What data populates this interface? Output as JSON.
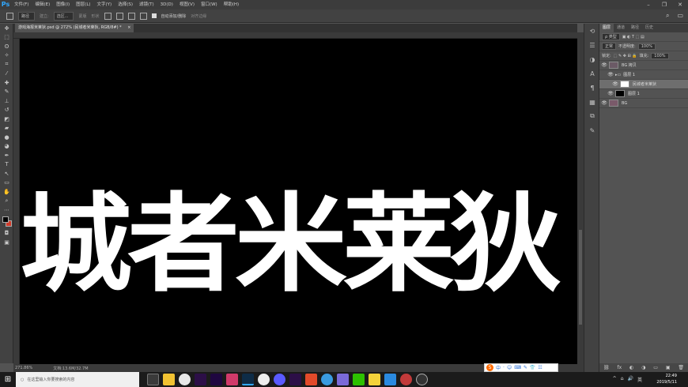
{
  "app": {
    "logo": "Ps"
  },
  "menu": [
    "文件(F)",
    "编辑(E)",
    "图像(I)",
    "图层(L)",
    "文字(Y)",
    "选择(S)",
    "滤镜(T)",
    "3D(D)",
    "视图(V)",
    "窗口(W)",
    "帮助(H)"
  ],
  "window_controls": {
    "minimize": "–",
    "restore": "❐",
    "close": "✕"
  },
  "options_bar": {
    "mode": "路径",
    "make_label": "建立:",
    "selection": "选区...",
    "mask": "蒙版",
    "shape": "形状",
    "auto_add_delete": "自动添加/删除",
    "align_edges": "对齐边缘"
  },
  "document": {
    "tab_title": "游戏海报米莱狄.psd @ 272% (民城者米莱狄, RGB/8#) *",
    "tab_close": "×"
  },
  "canvas_text": "城者米莱狄",
  "status": {
    "zoom": "271.86%",
    "doc": "文档:13.6M/32.7M"
  },
  "layers_panel": {
    "tabs": [
      "图层",
      "通道",
      "路径",
      "历史"
    ],
    "filter_label": "ρ 类型",
    "blend_mode": "正常",
    "opacity_label": "不透明度:",
    "opacity": "100%",
    "lock_label": "锁定:",
    "fill_label": "填充:",
    "fill": "100%",
    "layers": [
      {
        "name": "BG 拷贝",
        "eye": "👁",
        "active": false
      },
      {
        "name": "图层 1",
        "eye": "👁",
        "active": false
      },
      {
        "name": "民城者米莱狄",
        "eye": "👁",
        "active": true
      },
      {
        "name": "图层 1",
        "eye": "👁",
        "active": false
      },
      {
        "name": "BG",
        "eye": "👁",
        "active": false
      }
    ],
    "bottom_icons": [
      "⛓",
      "fx",
      "◐",
      "◑",
      "▭",
      "▣",
      "🗑"
    ]
  },
  "taskbar": {
    "search_placeholder": "在这里输入你要搜索的内容",
    "time": "22:49",
    "date": "2019/5/11",
    "lang": "英"
  },
  "ime": {
    "logo": "S",
    "items": [
      "中",
      "·",
      "☺",
      "⌨",
      "✎",
      "👕",
      "☷"
    ]
  }
}
